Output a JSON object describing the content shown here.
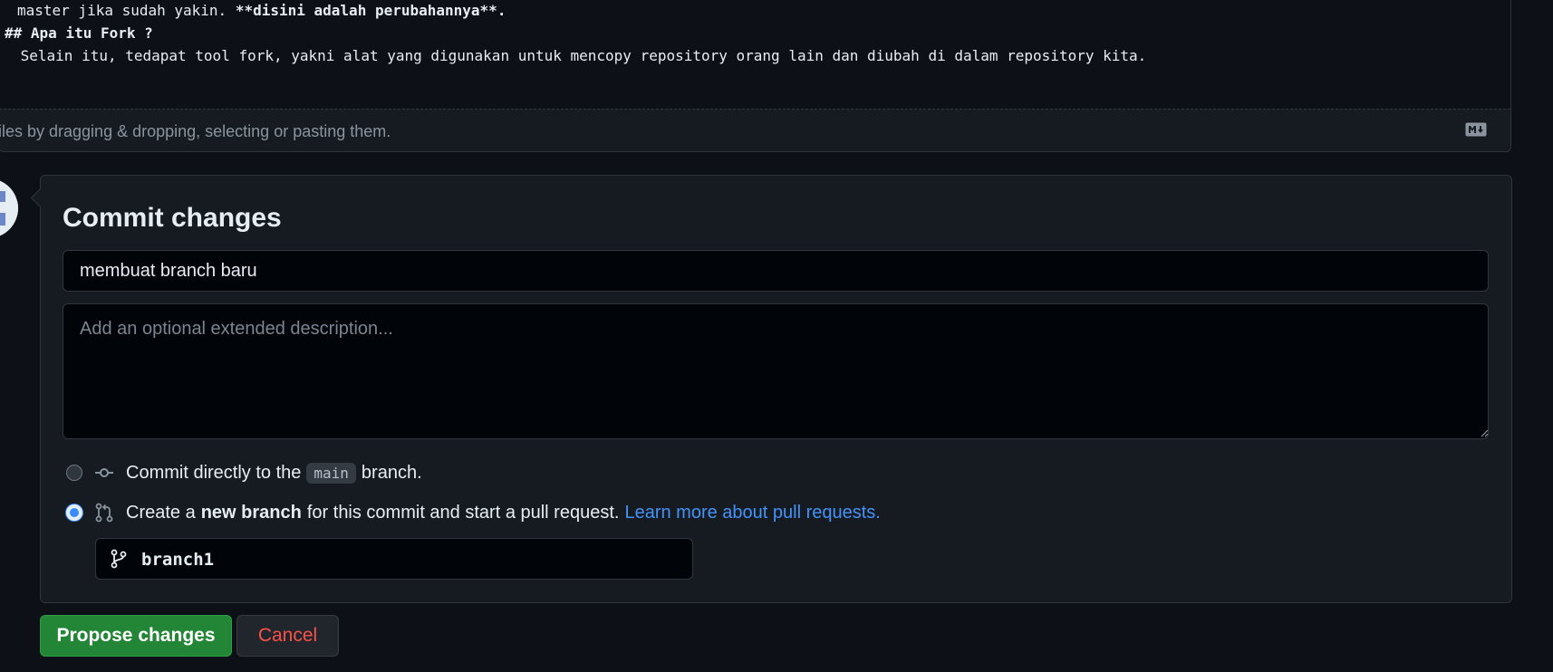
{
  "editor": {
    "lines": [
      {
        "plain": "master jika sudah yakin. ",
        "bold": "**disini adalah perubahannya**."
      },
      {
        "plain": "",
        "bold": "## Apa itu Fork ?"
      },
      {
        "plain": " Selain itu, tedapat tool fork, yakni alat yang digunakan untuk mencopy repository orang lain dan diubah di dalam repository kita.",
        "bold": ""
      }
    ],
    "attach_hint": "files by dragging & dropping, selecting or pasting them.",
    "markdown_icon": "markdown-icon"
  },
  "commit": {
    "title": "Commit changes",
    "summary_value": "membuat branch baru",
    "description_placeholder": "Add an optional extended description...",
    "option_direct": {
      "prefix": "Commit directly to the",
      "branch_chip": "main",
      "suffix": "branch.",
      "icon": "git-commit-icon",
      "selected": false
    },
    "option_new_branch": {
      "prefix": "Create a",
      "bold": "new branch",
      "suffix": "for this commit and start a pull request.",
      "link": "Learn more about pull requests.",
      "icon": "git-pull-request-icon",
      "selected": true
    },
    "new_branch_name": "branch1",
    "branch_icon": "git-branch-icon"
  },
  "buttons": {
    "propose": "Propose changes",
    "cancel": "Cancel"
  },
  "colors": {
    "background": "#0d1117",
    "panel": "#161b22",
    "primary_button": "#238636",
    "link": "#4493f8",
    "cancel_text": "#f85149"
  }
}
